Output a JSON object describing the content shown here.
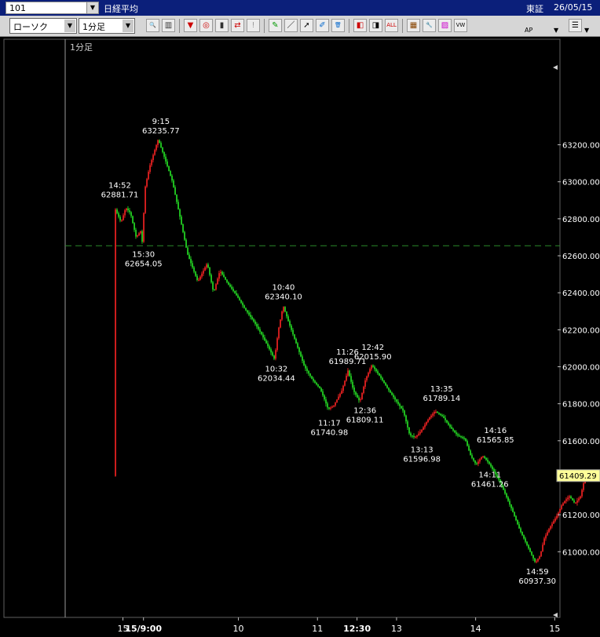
{
  "header": {
    "code": "101",
    "instrument": "日経平均",
    "exchange": "東証",
    "date": "26/05/15"
  },
  "toolbar": {
    "chart_type": "ローソク",
    "interval": "1分足",
    "buttons": [
      {
        "name": "zoom-icon",
        "glyph": "🔍",
        "color": "#1030a0"
      },
      {
        "name": "split-icon",
        "glyph": "▥",
        "color": "#333"
      },
      {
        "name": "pin-icon",
        "glyph": "▼",
        "color": "#c00"
      },
      {
        "name": "search-chart-icon",
        "glyph": "◎",
        "color": "#c00"
      },
      {
        "name": "bar-chart-icon",
        "glyph": "▮",
        "color": "#333"
      },
      {
        "name": "compare-icon",
        "glyph": "⇄",
        "color": "#c00"
      },
      {
        "name": "alert-icon",
        "glyph": "!",
        "color": "#999"
      },
      {
        "name": "pencil-icon",
        "glyph": "✎",
        "color": "#090"
      },
      {
        "name": "line-draw-icon",
        "glyph": "／",
        "color": "#000"
      },
      {
        "name": "cursor-icon",
        "glyph": "➚",
        "color": "#000"
      },
      {
        "name": "brush-icon",
        "glyph": "✐",
        "color": "#06c"
      },
      {
        "name": "trash-icon",
        "glyph": "🗑",
        "color": "#06c"
      },
      {
        "name": "candle-left-icon",
        "glyph": "◧",
        "color": "#c00"
      },
      {
        "name": "candle-right-icon",
        "glyph": "◨",
        "color": "#000"
      },
      {
        "name": "all-icon",
        "glyph": "ALL",
        "color": "#c00"
      },
      {
        "name": "grid-icon",
        "glyph": "▦",
        "color": "#840"
      },
      {
        "name": "wrench-icon",
        "glyph": "🔧",
        "color": "#c00"
      },
      {
        "name": "palette-icon",
        "glyph": "▨",
        "color": "#c0c"
      },
      {
        "name": "vwap-icon",
        "glyph": "VW",
        "color": "#000"
      }
    ],
    "vwap_bottom": "AP"
  },
  "colors": {
    "up": "#e02020",
    "down": "#22cc22",
    "reference_line": "#2a8a2a",
    "last_price_bg": "#ffff99"
  },
  "chart_data": {
    "type": "candlestick",
    "interval_label": "1分足",
    "ylim": [
      60860,
      63330
    ],
    "y_ticks": [
      61000,
      61200,
      61400,
      61600,
      61800,
      62000,
      62200,
      62400,
      62600,
      62800,
      63000,
      63200
    ],
    "y_tick_labels": [
      "61000.00",
      "61200.00",
      "61400.00",
      "61600.00",
      "61800.00",
      "62000.00",
      "62200.00",
      "62400.00",
      "62600.00",
      "62800.00",
      "63000.00",
      "63200.00"
    ],
    "x_ticks": [
      {
        "label": "15",
        "t": 0.04,
        "bold": false
      },
      {
        "label": "15/9:00",
        "t": 0.3,
        "bold": true
      },
      {
        "label": "10",
        "t": 1.5,
        "bold": false
      },
      {
        "label": "11",
        "t": 2.5,
        "bold": false
      },
      {
        "label": "12:30",
        "t": 3.0,
        "bold": true
      },
      {
        "label": "13",
        "t": 3.5,
        "bold": false
      },
      {
        "label": "14",
        "t": 4.5,
        "bold": false
      },
      {
        "label": "15",
        "t": 5.5,
        "bold": false
      }
    ],
    "reference_line": 62654.05,
    "last_price": 61409.29,
    "last_price_label": "61409.29",
    "path": [
      [
        -0.06,
        62870
      ],
      [
        0.03,
        62780
      ],
      [
        0.09,
        62860
      ],
      [
        0.15,
        62830
      ],
      [
        0.22,
        62700
      ],
      [
        0.29,
        62740
      ],
      [
        0.3,
        62654
      ],
      [
        0.33,
        62960
      ],
      [
        0.39,
        63080
      ],
      [
        0.44,
        63150
      ],
      [
        0.5,
        63230
      ],
      [
        0.58,
        63130
      ],
      [
        0.68,
        63000
      ],
      [
        0.78,
        62800
      ],
      [
        0.87,
        62610
      ],
      [
        1.0,
        62460
      ],
      [
        1.12,
        62560
      ],
      [
        1.2,
        62400
      ],
      [
        1.28,
        62520
      ],
      [
        1.38,
        62450
      ],
      [
        1.5,
        62380
      ],
      [
        1.6,
        62310
      ],
      [
        1.7,
        62250
      ],
      [
        1.8,
        62180
      ],
      [
        1.9,
        62100
      ],
      [
        1.97,
        62040
      ],
      [
        2.02,
        62200
      ],
      [
        2.08,
        62330
      ],
      [
        2.15,
        62240
      ],
      [
        2.25,
        62120
      ],
      [
        2.35,
        62000
      ],
      [
        2.45,
        61930
      ],
      [
        2.55,
        61880
      ],
      [
        2.65,
        61770
      ],
      [
        2.72,
        61790
      ],
      [
        2.82,
        61870
      ],
      [
        2.9,
        61980
      ],
      [
        2.97,
        61870
      ],
      [
        3.05,
        61810
      ],
      [
        3.12,
        61930
      ],
      [
        3.2,
        62010
      ],
      [
        3.3,
        61950
      ],
      [
        3.42,
        61870
      ],
      [
        3.5,
        61820
      ],
      [
        3.6,
        61760
      ],
      [
        3.68,
        61630
      ],
      [
        3.75,
        61620
      ],
      [
        3.82,
        61650
      ],
      [
        3.92,
        61720
      ],
      [
        4.0,
        61760
      ],
      [
        4.1,
        61730
      ],
      [
        4.18,
        61680
      ],
      [
        4.28,
        61630
      ],
      [
        4.38,
        61610
      ],
      [
        4.45,
        61520
      ],
      [
        4.52,
        61470
      ],
      [
        4.6,
        61520
      ],
      [
        4.68,
        61480
      ],
      [
        4.75,
        61430
      ],
      [
        4.82,
        61380
      ],
      [
        4.9,
        61300
      ],
      [
        4.98,
        61220
      ],
      [
        5.07,
        61120
      ],
      [
        5.17,
        61030
      ],
      [
        5.27,
        60940
      ],
      [
        5.33,
        60980
      ],
      [
        5.38,
        61070
      ],
      [
        5.45,
        61130
      ],
      [
        5.55,
        61200
      ],
      [
        5.6,
        61250
      ],
      [
        5.65,
        61280
      ],
      [
        5.7,
        61300
      ],
      [
        5.77,
        61260
      ],
      [
        5.84,
        61300
      ],
      [
        5.9,
        61409
      ]
    ],
    "annotations": [
      {
        "time": "14:52",
        "value": "62881.71",
        "t": 0.0,
        "v": 62890,
        "pos": "above"
      },
      {
        "time": "9:15",
        "value": "63235.77",
        "t": 0.52,
        "v": 63235.77,
        "pos": "above"
      },
      {
        "time": "15:30",
        "value": "62654.05",
        "t": 0.3,
        "v": 62654.05,
        "pos": "below"
      },
      {
        "time": "10:40",
        "value": "62340.10",
        "t": 2.07,
        "v": 62340.1,
        "pos": "above"
      },
      {
        "time": "10:32",
        "value": "62034.44",
        "t": 1.98,
        "v": 62034.44,
        "pos": "below"
      },
      {
        "time": "11:26",
        "value": "61989.71",
        "t": 2.88,
        "v": 61989.71,
        "pos": "above"
      },
      {
        "time": "12:42",
        "value": "62015.90",
        "t": 3.2,
        "v": 62015.9,
        "pos": "above"
      },
      {
        "time": "12:36",
        "value": "61809.11",
        "t": 3.1,
        "v": 61809.11,
        "pos": "below"
      },
      {
        "time": "11:17",
        "value": "61740.98",
        "t": 2.65,
        "v": 61740.98,
        "pos": "below"
      },
      {
        "time": "13:35",
        "value": "61789.14",
        "t": 4.07,
        "v": 61789.14,
        "pos": "above"
      },
      {
        "time": "13:13",
        "value": "61596.98",
        "t": 3.82,
        "v": 61596.98,
        "pos": "below"
      },
      {
        "time": "14:16",
        "value": "61565.85",
        "t": 4.75,
        "v": 61565.85,
        "pos": "above"
      },
      {
        "time": "14:11",
        "value": "61461.26",
        "t": 4.68,
        "v": 61461.26,
        "pos": "below"
      },
      {
        "time": "14:59",
        "value": "60937.30",
        "t": 5.28,
        "v": 60937.3,
        "pos": "below"
      }
    ]
  }
}
